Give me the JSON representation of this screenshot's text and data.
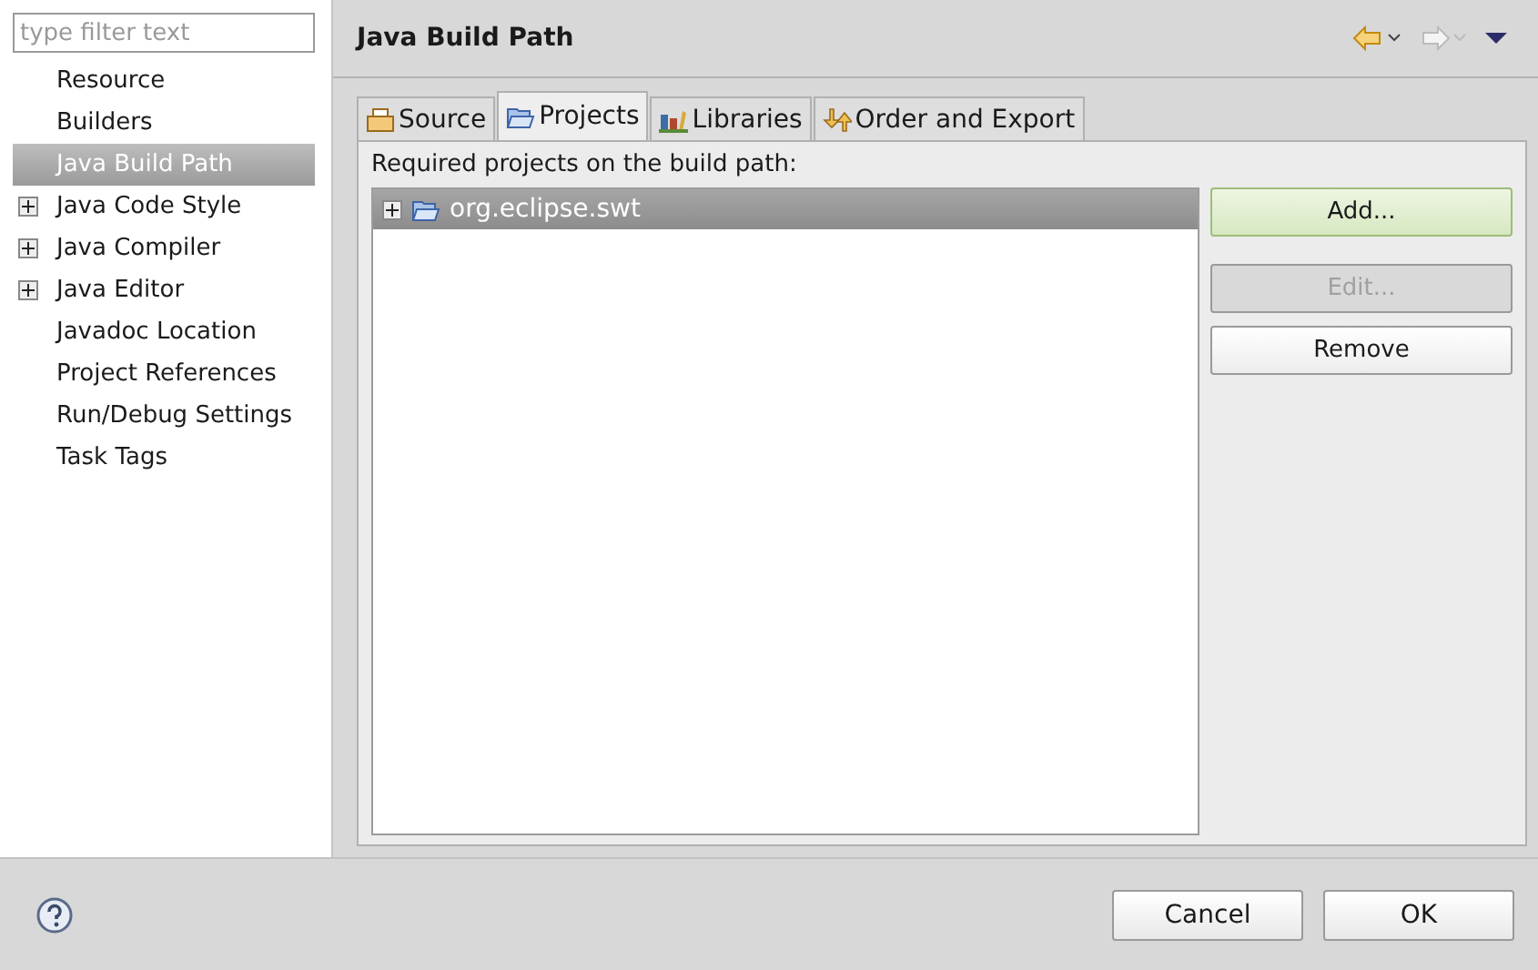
{
  "filter": {
    "placeholder": "type filter text"
  },
  "sidebar": {
    "items": [
      {
        "label": "Resource",
        "expandable": false,
        "selected": false
      },
      {
        "label": "Builders",
        "expandable": false,
        "selected": false
      },
      {
        "label": "Java Build Path",
        "expandable": false,
        "selected": true
      },
      {
        "label": "Java Code Style",
        "expandable": true,
        "selected": false
      },
      {
        "label": "Java Compiler",
        "expandable": true,
        "selected": false
      },
      {
        "label": "Java Editor",
        "expandable": true,
        "selected": false
      },
      {
        "label": "Javadoc Location",
        "expandable": false,
        "selected": false
      },
      {
        "label": "Project References",
        "expandable": false,
        "selected": false
      },
      {
        "label": "Run/Debug Settings",
        "expandable": false,
        "selected": false
      },
      {
        "label": "Task Tags",
        "expandable": false,
        "selected": false
      }
    ]
  },
  "page": {
    "title": "Java Build Path",
    "tabs": [
      {
        "label": "Source",
        "kind": "source",
        "selected": false
      },
      {
        "label": "Projects",
        "kind": "projects",
        "selected": true
      },
      {
        "label": "Libraries",
        "kind": "libraries",
        "selected": false
      },
      {
        "label": "Order and Export",
        "kind": "order",
        "selected": false
      }
    ],
    "list_label": "Required projects on the build path:",
    "projects": [
      {
        "label": "org.eclipse.swt",
        "expandable": true,
        "selected": true
      }
    ],
    "buttons": [
      {
        "label": "Add...",
        "default": true,
        "disabled": false
      },
      {
        "label": "Edit...",
        "default": false,
        "disabled": true
      },
      {
        "label": "Remove",
        "default": false,
        "disabled": false
      }
    ]
  },
  "footer": {
    "buttons": [
      "Cancel",
      "OK"
    ]
  }
}
